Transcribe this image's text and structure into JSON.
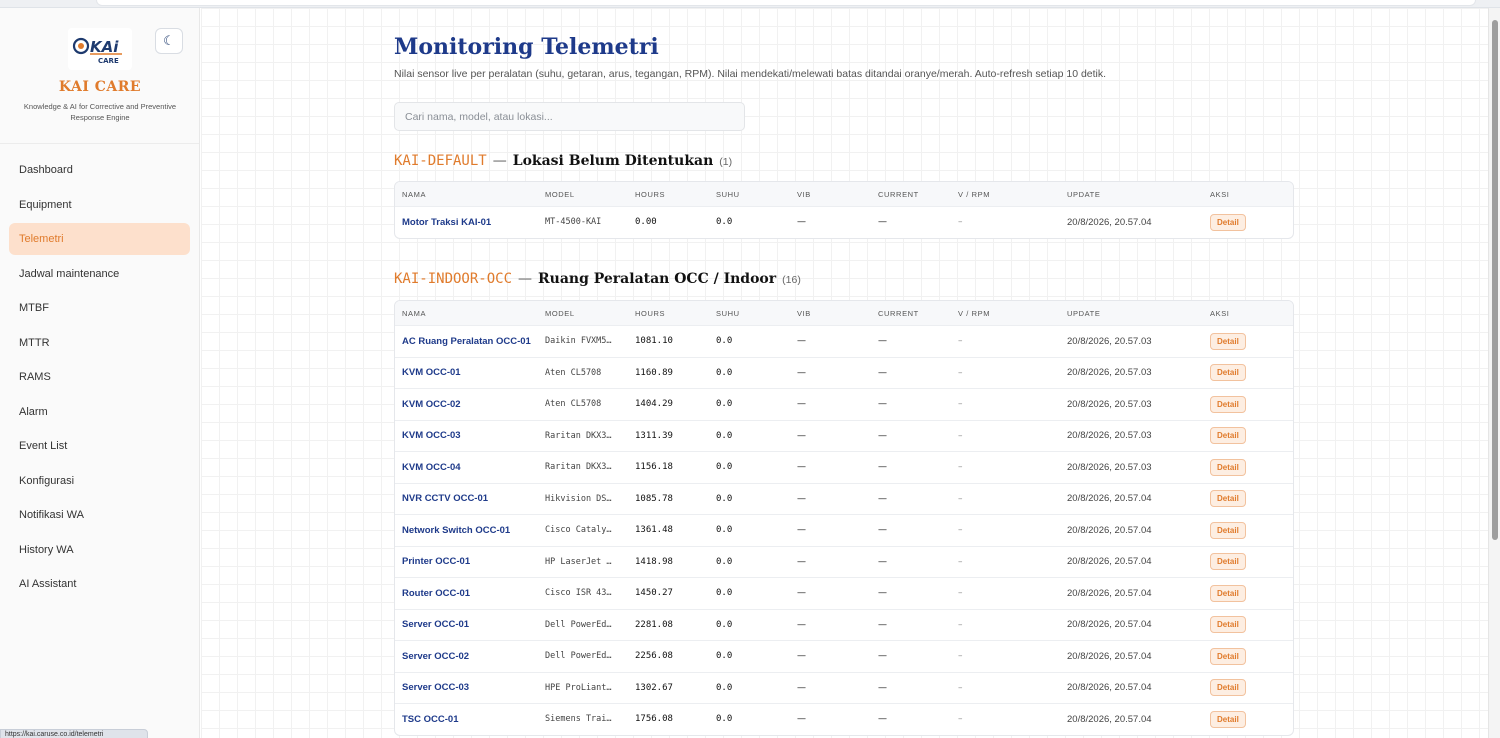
{
  "sidebar": {
    "brand_title": "KAI CARE",
    "brand_subtitle": "Knowledge & AI for Corrective and Preventive Response Engine",
    "logo_text": "KAI CARE",
    "theme_toggle_icon": "moon-icon",
    "items": [
      {
        "label": "Dashboard",
        "active": false
      },
      {
        "label": "Equipment",
        "active": false
      },
      {
        "label": "Telemetri",
        "active": true
      },
      {
        "label": "Jadwal maintenance",
        "active": false
      },
      {
        "label": "MTBF",
        "active": false
      },
      {
        "label": "MTTR",
        "active": false
      },
      {
        "label": "RAMS",
        "active": false
      },
      {
        "label": "Alarm",
        "active": false
      },
      {
        "label": "Event List",
        "active": false
      },
      {
        "label": "Konfigurasi",
        "active": false
      },
      {
        "label": "Notifikasi WA",
        "active": false
      },
      {
        "label": "History WA",
        "active": false
      },
      {
        "label": "AI Assistant",
        "active": false
      }
    ]
  },
  "status_url": "https://kai.caruse.co.id/telemetri",
  "page": {
    "title": "Monitoring Telemetri",
    "description": "Nilai sensor live per peralatan (suhu, getaran, arus, tegangan, RPM). Nilai mendekati/melewati batas ditandai oranye/merah. Auto-refresh setiap 10 detik.",
    "search_placeholder": "Cari nama, model, atau lokasi..."
  },
  "columns": [
    "NAMA",
    "MODEL",
    "HOURS",
    "SUHU",
    "VIB",
    "CURRENT",
    "V / RPM",
    "UPDATE",
    "AKSI"
  ],
  "groups": [
    {
      "code": "KAI-DEFAULT",
      "dash": "—",
      "name": "Lokasi Belum Ditentukan",
      "count": "(1)",
      "rows": [
        {
          "name": "Motor Traksi KAI-01",
          "model": "MT-4500-KAI",
          "hours": "0.00",
          "suhu": "0.0",
          "vib": "—",
          "current": "—",
          "vrpm": "–",
          "update": "20/8/2026, 20.57.04",
          "action": "Detail"
        }
      ]
    },
    {
      "code": "KAI-INDOOR-OCC",
      "dash": "—",
      "name": "Ruang Peralatan OCC / Indoor",
      "count": "(16)",
      "rows": [
        {
          "name": "AC Ruang Peralatan OCC-01",
          "model": "Daikin FVXM5…",
          "hours": "1081.10",
          "suhu": "0.0",
          "vib": "—",
          "current": "—",
          "vrpm": "–",
          "update": "20/8/2026, 20.57.03",
          "action": "Detail"
        },
        {
          "name": "KVM OCC-01",
          "model": "Aten CL5708",
          "hours": "1160.89",
          "suhu": "0.0",
          "vib": "—",
          "current": "—",
          "vrpm": "–",
          "update": "20/8/2026, 20.57.03",
          "action": "Detail"
        },
        {
          "name": "KVM OCC-02",
          "model": "Aten CL5708",
          "hours": "1404.29",
          "suhu": "0.0",
          "vib": "—",
          "current": "—",
          "vrpm": "–",
          "update": "20/8/2026, 20.57.03",
          "action": "Detail"
        },
        {
          "name": "KVM OCC-03",
          "model": "Raritan DKX3…",
          "hours": "1311.39",
          "suhu": "0.0",
          "vib": "—",
          "current": "—",
          "vrpm": "–",
          "update": "20/8/2026, 20.57.03",
          "action": "Detail"
        },
        {
          "name": "KVM OCC-04",
          "model": "Raritan DKX3…",
          "hours": "1156.18",
          "suhu": "0.0",
          "vib": "—",
          "current": "—",
          "vrpm": "–",
          "update": "20/8/2026, 20.57.03",
          "action": "Detail"
        },
        {
          "name": "NVR CCTV OCC-01",
          "model": "Hikvision DS…",
          "hours": "1085.78",
          "suhu": "0.0",
          "vib": "—",
          "current": "—",
          "vrpm": "–",
          "update": "20/8/2026, 20.57.04",
          "action": "Detail"
        },
        {
          "name": "Network Switch OCC-01",
          "model": "Cisco Cataly…",
          "hours": "1361.48",
          "suhu": "0.0",
          "vib": "—",
          "current": "—",
          "vrpm": "–",
          "update": "20/8/2026, 20.57.04",
          "action": "Detail"
        },
        {
          "name": "Printer OCC-01",
          "model": "HP LaserJet …",
          "hours": "1418.98",
          "suhu": "0.0",
          "vib": "—",
          "current": "—",
          "vrpm": "–",
          "update": "20/8/2026, 20.57.04",
          "action": "Detail"
        },
        {
          "name": "Router OCC-01",
          "model": "Cisco ISR 43…",
          "hours": "1450.27",
          "suhu": "0.0",
          "vib": "—",
          "current": "—",
          "vrpm": "–",
          "update": "20/8/2026, 20.57.04",
          "action": "Detail"
        },
        {
          "name": "Server OCC-01",
          "model": "Dell PowerEd…",
          "hours": "2281.08",
          "suhu": "0.0",
          "vib": "—",
          "current": "—",
          "vrpm": "–",
          "update": "20/8/2026, 20.57.04",
          "action": "Detail"
        },
        {
          "name": "Server OCC-02",
          "model": "Dell PowerEd…",
          "hours": "2256.08",
          "suhu": "0.0",
          "vib": "—",
          "current": "—",
          "vrpm": "–",
          "update": "20/8/2026, 20.57.04",
          "action": "Detail"
        },
        {
          "name": "Server OCC-03",
          "model": "HPE ProLiant…",
          "hours": "1302.67",
          "suhu": "0.0",
          "vib": "—",
          "current": "—",
          "vrpm": "–",
          "update": "20/8/2026, 20.57.04",
          "action": "Detail"
        },
        {
          "name": "TSC OCC-01",
          "model": "Siemens Trai…",
          "hours": "1756.08",
          "suhu": "0.0",
          "vib": "—",
          "current": "—",
          "vrpm": "–",
          "update": "20/8/2026, 20.57.04",
          "action": "Detail"
        }
      ]
    }
  ],
  "colors": {
    "accent": "#e07b2c",
    "title_blue": "#1e3a8a",
    "active_bg": "#fde0cc"
  }
}
